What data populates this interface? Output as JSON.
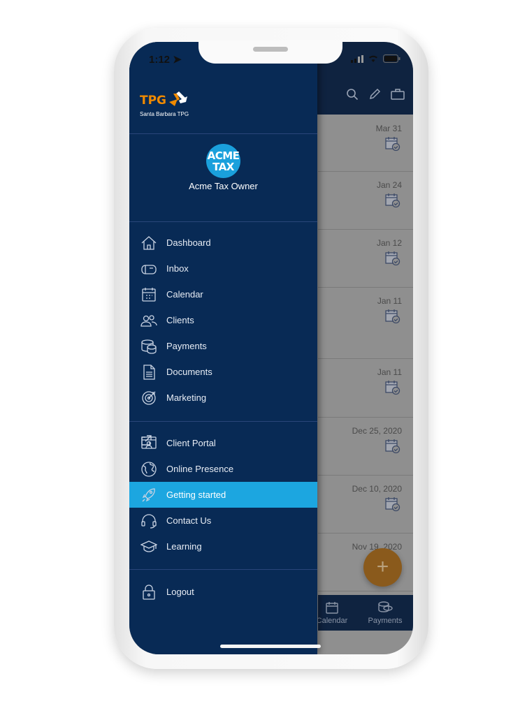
{
  "status": {
    "time": "1:12"
  },
  "brand": {
    "logo_text": "TPG",
    "logo_subtitle": "Santa Barbara TPG",
    "accent": "#f08a00"
  },
  "profile": {
    "avatar_line1": "ACME",
    "avatar_line2": "TAX",
    "name": "Acme Tax Owner"
  },
  "menu": {
    "main": [
      {
        "label": "Dashboard",
        "icon": "home-icon"
      },
      {
        "label": "Inbox",
        "icon": "mailbox-icon"
      },
      {
        "label": "Calendar",
        "icon": "calendar-icon"
      },
      {
        "label": "Clients",
        "icon": "users-icon"
      },
      {
        "label": "Payments",
        "icon": "coins-icon"
      },
      {
        "label": "Documents",
        "icon": "document-icon"
      },
      {
        "label": "Marketing",
        "icon": "target-icon"
      }
    ],
    "secondary": [
      {
        "label": "Client Portal",
        "icon": "portal-icon",
        "external": true
      },
      {
        "label": "Online Presence",
        "icon": "globe-icon"
      },
      {
        "label": "Getting started",
        "icon": "rocket-icon",
        "active": true
      },
      {
        "label": "Contact Us",
        "icon": "headset-icon"
      },
      {
        "label": "Learning",
        "icon": "graduation-cap-icon"
      }
    ],
    "logout": "Logout"
  },
  "list": {
    "dates": [
      "Mar 31",
      "Jan 24",
      "Jan 12",
      "Jan 11",
      "Jan 11",
      "Dec 25, 2020",
      "Dec 10, 2020",
      "Nov 19, 2020"
    ]
  },
  "bottom_nav": {
    "calendar": "Calendar",
    "payments": "Payments"
  },
  "fab": "+",
  "colors": {
    "drawer": "#082a55",
    "active": "#1ca6e0",
    "avatar": "#1aa0dc"
  }
}
